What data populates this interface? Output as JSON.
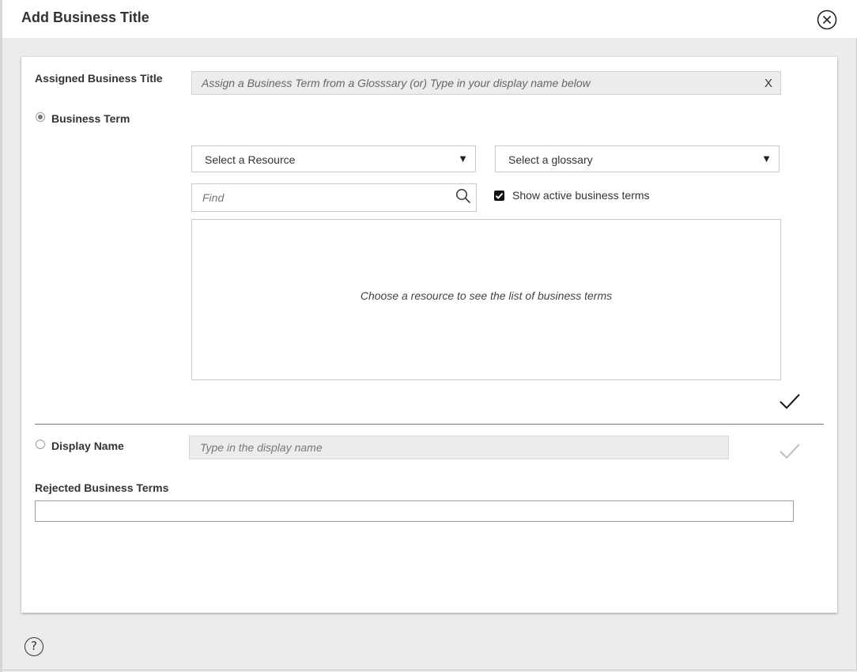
{
  "dialog": {
    "title": "Add Business Title",
    "close_icon": "close-circle-icon",
    "help_icon": "help-circle-icon",
    "help_label": "?"
  },
  "assigned": {
    "label": "Assigned Business Title",
    "placeholder": "Assign a Business Term from a Glosssary (or) Type in your display name below",
    "clear_label": "X"
  },
  "business_term": {
    "label": "Business Term",
    "selected": true,
    "resource_select": {
      "value": "Select a Resource",
      "arrow": "▼"
    },
    "glossary_select": {
      "value": "Select a glossary",
      "arrow": "▼"
    },
    "find": {
      "placeholder": "Find",
      "icon": "search-icon"
    },
    "show_active": {
      "label": "Show active business terms",
      "checked": true
    },
    "list_empty_text": "Choose a resource to see the list of business terms",
    "confirm_icon": "checkmark-icon"
  },
  "display_name": {
    "label": "Display Name",
    "selected": false,
    "placeholder": "Type in the display name",
    "confirm_icon": "checkmark-icon"
  },
  "rejected": {
    "label": "Rejected Business Terms",
    "value": ""
  },
  "colors": {
    "background": "#ececec",
    "panel": "#ffffff",
    "readonly_field": "#ececec",
    "text": "#333333",
    "disabled_check": "#bdbdbd"
  }
}
